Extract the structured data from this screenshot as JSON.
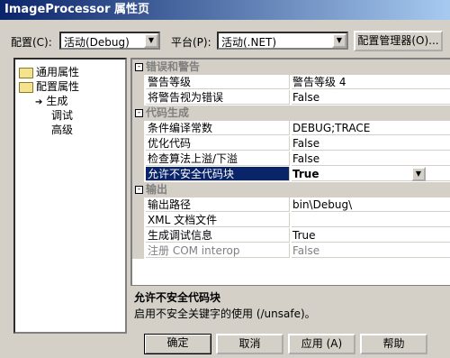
{
  "window": {
    "title": "ImageProcessor 属性页"
  },
  "toolbar": {
    "config_label": "配置(C):",
    "config_value": "活动(Debug)",
    "platform_label": "平台(P):",
    "platform_value": "活动(.NET)",
    "config_manager_button": "配置管理器(O)..."
  },
  "tree": {
    "items": [
      {
        "label": "通用属性"
      },
      {
        "label": "配置属性"
      },
      {
        "label": "生成"
      },
      {
        "label": "调试"
      },
      {
        "label": "高级"
      }
    ]
  },
  "grid": {
    "categories": [
      {
        "title": "错误和警告",
        "rows": [
          {
            "key": "警告等级",
            "value": "警告等级 4"
          },
          {
            "key": "将警告视为错误",
            "value": "False"
          }
        ]
      },
      {
        "title": "代码生成",
        "rows": [
          {
            "key": "条件编译常数",
            "value": "DEBUG;TRACE"
          },
          {
            "key": "优化代码",
            "value": "False"
          },
          {
            "key": "检查算法上溢/下溢",
            "value": "False"
          },
          {
            "key": "允许不安全代码块",
            "value": "True"
          }
        ]
      },
      {
        "title": "输出",
        "rows": [
          {
            "key": "输出路径",
            "value": "bin\\Debug\\"
          },
          {
            "key": "XML 文档文件",
            "value": ""
          },
          {
            "key": "生成调试信息",
            "value": "True"
          },
          {
            "key": "注册 COM interop",
            "value": "False"
          }
        ]
      }
    ]
  },
  "description": {
    "title": "允许不安全代码块",
    "text": "启用不安全关键字的使用 (/unsafe)。"
  },
  "buttons": {
    "ok": "确定",
    "cancel": "取消",
    "apply": "应用 (A)",
    "help": "帮助"
  },
  "colors": {
    "selection": "#0a246a",
    "face": "#d4d0c8"
  }
}
